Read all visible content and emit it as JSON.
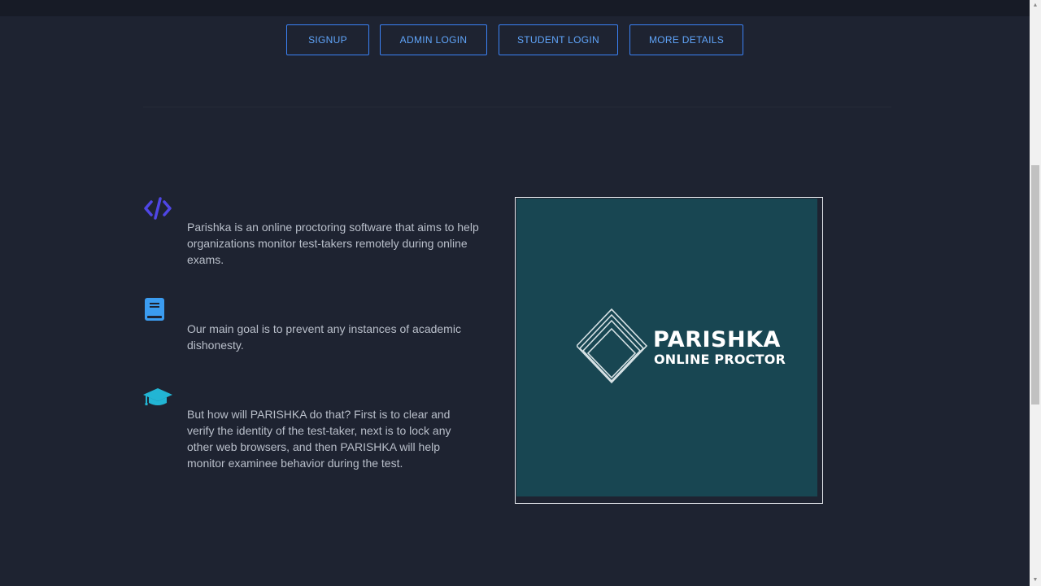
{
  "nav": {
    "signup": "SIGNUP",
    "admin_login": "ADMIN LOGIN",
    "student_login": "STUDENT LOGIN",
    "more_details": "MORE DETAILS"
  },
  "section": {
    "title": ""
  },
  "features": [
    {
      "icon": "code-icon",
      "title": "",
      "text": "Parishka is an online proctoring software that aims to help organizations monitor test-takers remotely during online exams."
    },
    {
      "icon": "book-icon",
      "title": "",
      "text": "Our main goal is to prevent any instances of academic dishonesty."
    },
    {
      "icon": "graduation-cap-icon",
      "title": "",
      "text": "But how will PARISHKA do that? First is to clear and verify the identity of the test-taker, next is to lock any other web browsers, and then PARISHKA will help monitor examinee behavior during the test."
    }
  ],
  "logo": {
    "title": "PARISHKA",
    "subtitle": "ONLINE PROCTOR"
  },
  "colors": {
    "background": "#1e2331",
    "accent": "#3b82f6",
    "code_icon": "#4f46e5",
    "book_icon": "#3b9cf0",
    "cap_icon": "#22b5d4",
    "logo_bg": "#184652"
  }
}
